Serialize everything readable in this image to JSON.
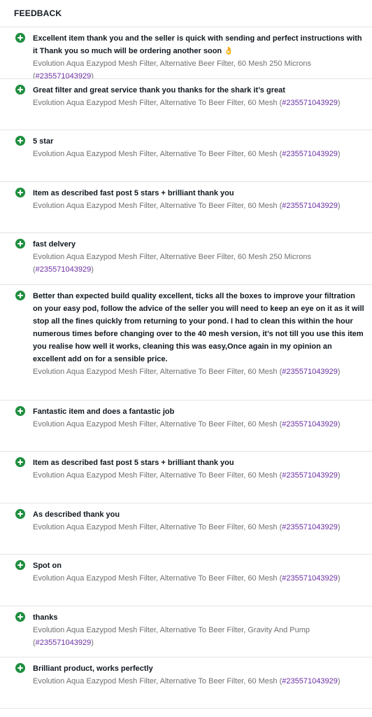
{
  "header": {
    "title": "FEEDBACK"
  },
  "feedback": [
    {
      "comment": "Excellent item thank you and the seller is quick with sending and perfect instructions with it Thank you so much will be ordering another soon 👌",
      "item_title": "Evolution Aqua Eazypod Mesh Filter, Alternative Beer Filter, 60 Mesh 250 Microns",
      "item_number": "235571043929"
    },
    {
      "comment": "Great filter and great service thank you thanks for the shark it’s great",
      "item_title": "Evolution Aqua Eazypod Mesh Filter, Alternative To Beer Filter, 60 Mesh",
      "item_number": "235571043929"
    },
    {
      "comment": "5 star",
      "item_title": "Evolution Aqua Eazypod Mesh Filter, Alternative To Beer Filter, 60 Mesh",
      "item_number": "235571043929"
    },
    {
      "comment": "Item as described fast post 5 stars + brilliant thank you",
      "item_title": "Evolution Aqua Eazypod Mesh Filter, Alternative To Beer Filter, 60 Mesh",
      "item_number": "235571043929"
    },
    {
      "comment": "fast delvery",
      "item_title": "Evolution Aqua Eazypod Mesh Filter, Alternative Beer Filter, 60 Mesh 250 Microns",
      "item_number": "235571043929"
    },
    {
      "comment": "Better than expected build quality excellent, ticks all the boxes to improve your filtration on your easy pod, follow the advice of the seller you will need to keep an eye on it as it will stop all the fines quickly from returning to your pond. I had to clean this within the hour numerous times before changing over to the 40 mesh version, it’s not till you use this item you realise how well it works, cleaning this was easy,Once again in my opinion an excellent add on for a sensible price.",
      "item_title": "Evolution Aqua Eazypod Mesh Filter, Alternative To Beer Filter, 60 Mesh",
      "item_number": "235571043929"
    },
    {
      "comment": "Fantastic item and does a fantastic job",
      "item_title": "Evolution Aqua Eazypod Mesh Filter, Alternative To Beer Filter, 60 Mesh",
      "item_number": "235571043929"
    },
    {
      "comment": "Item as described fast post 5 stars + brilliant thank you",
      "item_title": "Evolution Aqua Eazypod Mesh Filter, Alternative To Beer Filter, 60 Mesh",
      "item_number": "235571043929"
    },
    {
      "comment": "As described thank you",
      "item_title": "Evolution Aqua Eazypod Mesh Filter, Alternative To Beer Filter, 60 Mesh",
      "item_number": "235571043929"
    },
    {
      "comment": "Spot on",
      "item_title": "Evolution Aqua Eazypod Mesh Filter, Alternative To Beer Filter, 60 Mesh",
      "item_number": "235571043929"
    },
    {
      "comment": "thanks",
      "item_title": "Evolution Aqua Eazypod Mesh Filter, Alternative To Beer Filter, Gravity And Pump",
      "item_number": "235571043929"
    },
    {
      "comment": "Brilliant product, works perfectly",
      "item_title": "Evolution Aqua Eazypod Mesh Filter, Alternative To Beer Filter, 60 Mesh",
      "item_number": "235571043929"
    }
  ],
  "icons": {
    "rating": "positive-plus-circle-icon"
  },
  "colors": {
    "positive": "#1e8e3e",
    "link": "#6b2fa3",
    "meta": "#707070"
  }
}
